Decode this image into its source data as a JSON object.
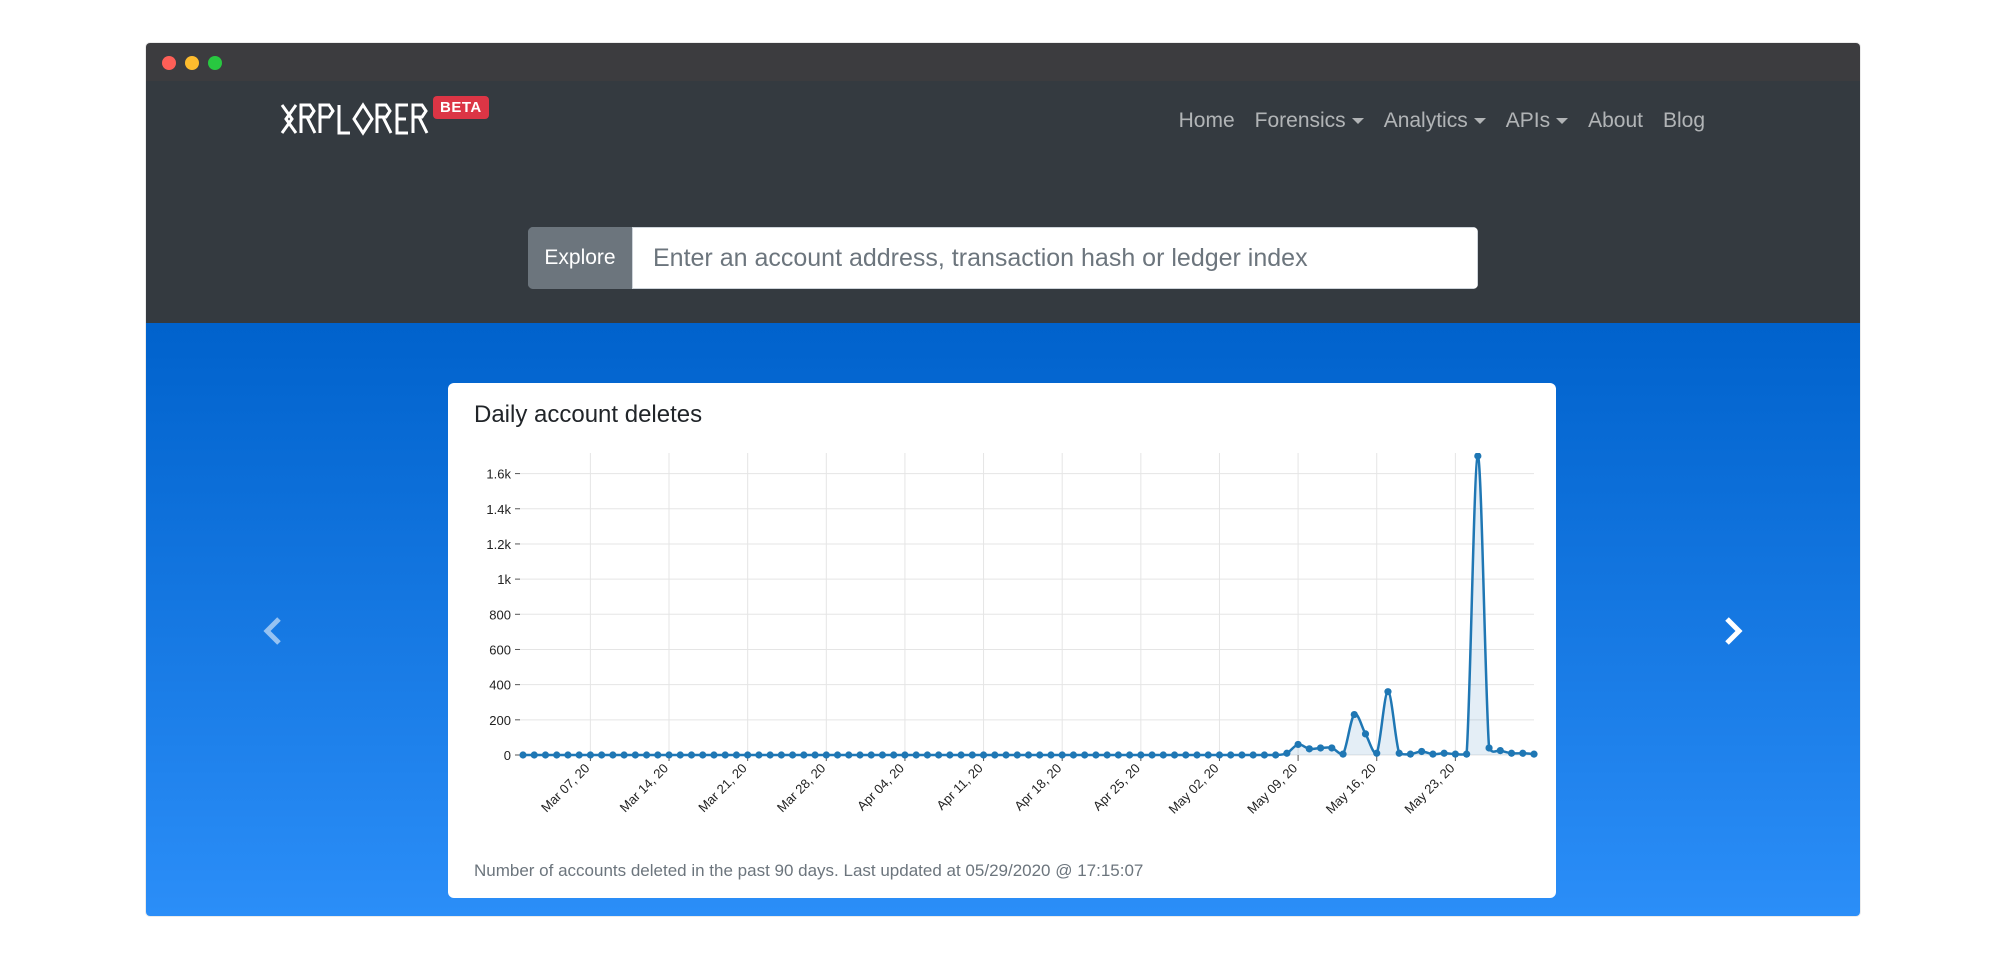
{
  "window": {
    "controls": [
      "close",
      "minimize",
      "zoom"
    ]
  },
  "brand": {
    "logo_text": "XRPLORER",
    "badge": "BETA"
  },
  "nav": {
    "items": [
      {
        "label": "Home",
        "dropdown": false
      },
      {
        "label": "Forensics",
        "dropdown": true
      },
      {
        "label": "Analytics",
        "dropdown": true
      },
      {
        "label": "APIs",
        "dropdown": true
      },
      {
        "label": "About",
        "dropdown": false
      },
      {
        "label": "Blog",
        "dropdown": false
      }
    ]
  },
  "search": {
    "button_label": "Explore",
    "placeholder": "Enter an account address, transaction hash or ledger index"
  },
  "carousel": {
    "prev_icon": "chevron-left-icon",
    "next_icon": "chevron-right-icon"
  },
  "card": {
    "title": "Daily account deletes",
    "footer": "Number of accounts deleted in the past 90 days. Last updated at 05/29/2020 @ 17:15:07"
  },
  "colors": {
    "line": "#1f77b4",
    "navbar": "#343a40",
    "badge": "#dc3545"
  },
  "chart_data": {
    "type": "line",
    "title": "Daily account deletes",
    "xlabel": "",
    "ylabel": "",
    "ylim": [
      0,
      1700
    ],
    "yticks": [
      0,
      200,
      400,
      600,
      800,
      1000,
      1200,
      1400,
      1600
    ],
    "ytick_labels": [
      "0",
      "200",
      "400",
      "600",
      "800",
      "1k",
      "1.2k",
      "1.4k",
      "1.6k"
    ],
    "xtick_labels": [
      "Mar 07, 20",
      "Mar 14, 20",
      "Mar 21, 20",
      "Mar 28, 20",
      "Apr 04, 20",
      "Apr 11, 20",
      "Apr 18, 20",
      "Apr 25, 20",
      "May 02, 20",
      "May 09, 20",
      "May 16, 20",
      "May 23, 20"
    ],
    "xtick_index": [
      6,
      13,
      20,
      27,
      34,
      41,
      48,
      55,
      62,
      69,
      76,
      83
    ],
    "grid": true,
    "series": [
      {
        "values": [
          0,
          0,
          0,
          0,
          0,
          0,
          0,
          0,
          0,
          0,
          0,
          0,
          0,
          0,
          0,
          0,
          0,
          0,
          0,
          0,
          0,
          0,
          0,
          0,
          0,
          0,
          0,
          0,
          0,
          0,
          0,
          0,
          0,
          0,
          0,
          0,
          0,
          0,
          0,
          0,
          0,
          0,
          0,
          0,
          0,
          0,
          0,
          0,
          0,
          0,
          0,
          0,
          0,
          0,
          0,
          0,
          0,
          0,
          0,
          0,
          0,
          0,
          0,
          0,
          0,
          0,
          0,
          0,
          10,
          60,
          35,
          40,
          40,
          5,
          230,
          120,
          10,
          360,
          10,
          5,
          20,
          5,
          10,
          5,
          5,
          1700,
          40,
          25,
          10,
          10,
          5
        ]
      }
    ]
  }
}
